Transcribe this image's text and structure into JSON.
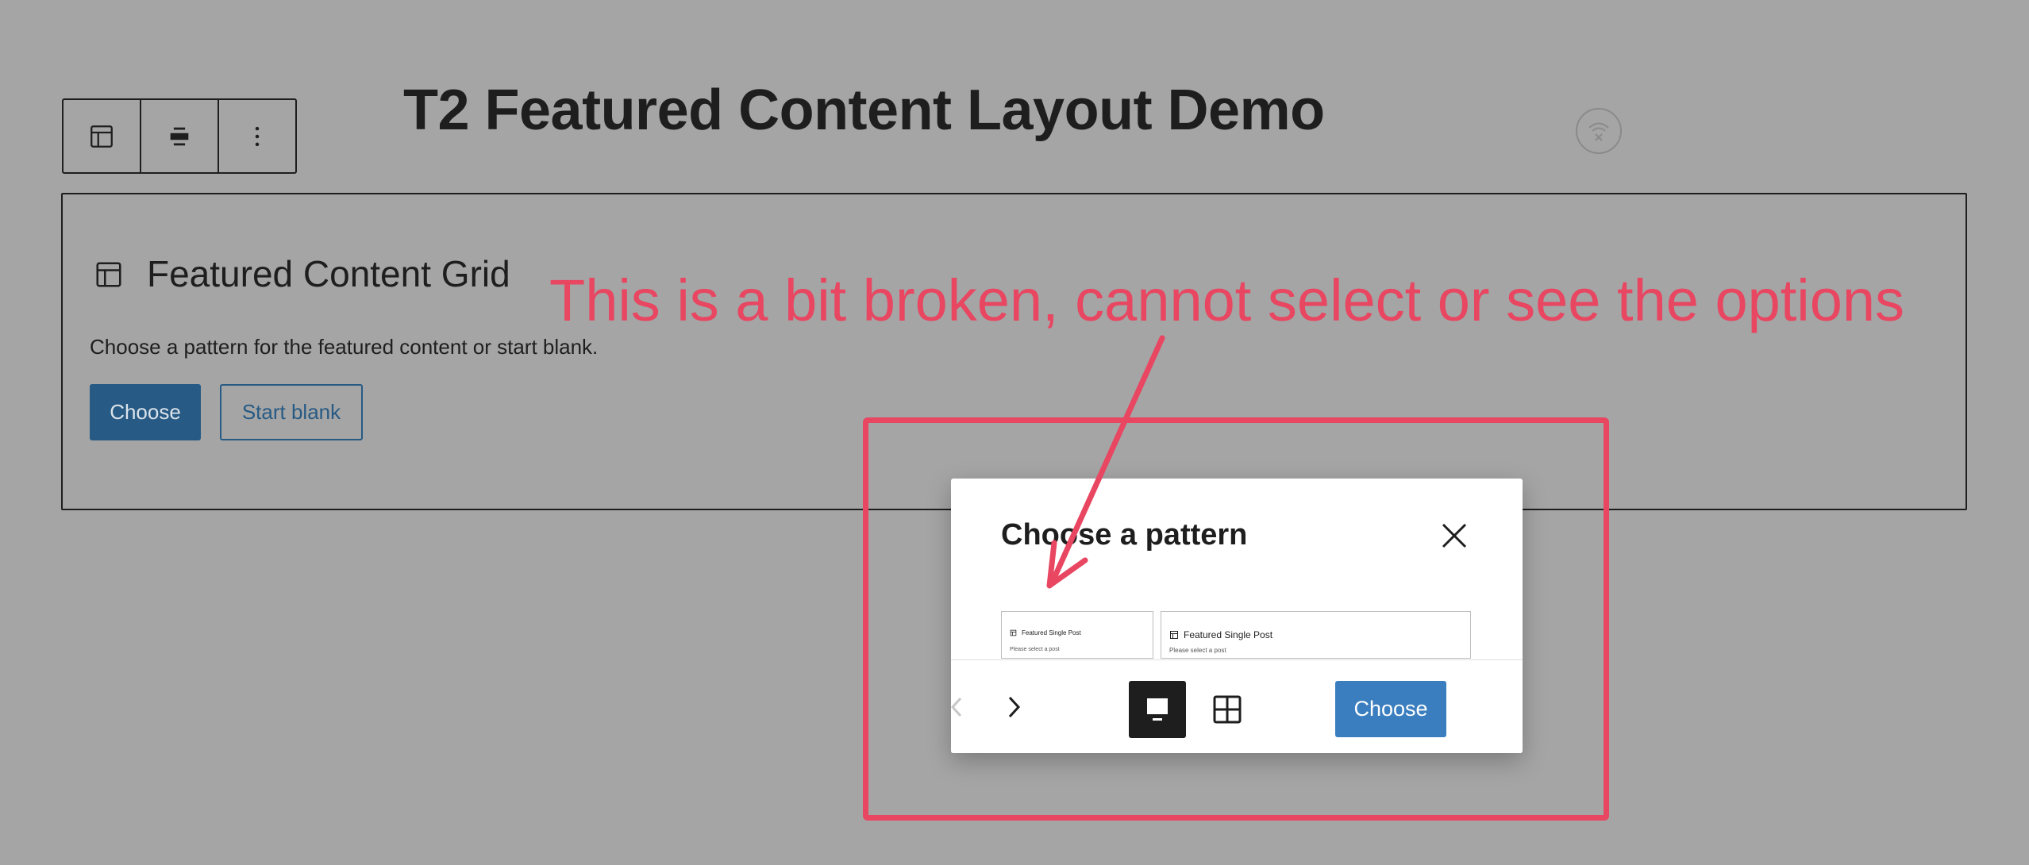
{
  "page": {
    "title": "T2 Featured Content Layout Demo"
  },
  "toolbar": {
    "items": [
      {
        "icon": "layout-icon"
      },
      {
        "icon": "align-center-icon"
      },
      {
        "icon": "more-vertical-icon"
      }
    ]
  },
  "status": {
    "icon": "wifi-off-icon"
  },
  "block": {
    "icon": "layout-icon",
    "title": "Featured Content Grid",
    "description": "Choose a pattern for the featured content or start blank.",
    "choose_label": "Choose",
    "blank_label": "Start blank"
  },
  "modal": {
    "title": "Choose a pattern",
    "close_icon": "close-icon",
    "previews": [
      {
        "title": "Featured Single Post",
        "subtitle": "Please select a post"
      },
      {
        "title": "Featured Single Post",
        "subtitle": "Please select a post"
      }
    ],
    "prev_icon": "chevron-left-icon",
    "next_icon": "chevron-right-icon",
    "view_single_icon": "single-view-icon",
    "view_grid_icon": "grid-view-icon",
    "choose_label": "Choose"
  },
  "annotation": {
    "text": "This is a bit broken, cannot select or see the options",
    "color": "#e84661"
  },
  "colors": {
    "background": "#a5a5a5",
    "primary_button": "#275a84",
    "modal_button": "#3a7ebf"
  }
}
